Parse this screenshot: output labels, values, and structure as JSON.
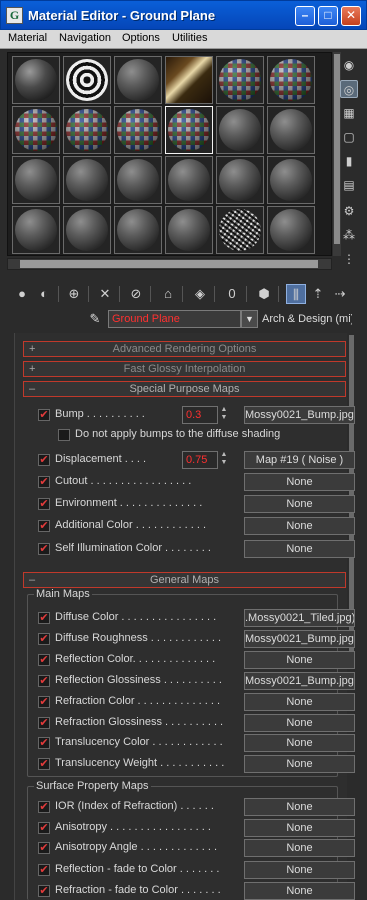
{
  "window": {
    "title": "Material Editor - Ground Plane",
    "app_icon": "G",
    "minimize": "–",
    "maximize": "□",
    "close": "✕"
  },
  "menu": [
    "Material",
    "Navigation",
    "Options",
    "Utilities"
  ],
  "material": {
    "name": "Ground Plane",
    "type": "Arch & Design (mi)"
  },
  "rollouts": {
    "advanced": "Advanced Rendering Options",
    "glossy": "Fast Glossy Interpolation",
    "special": "Special Purpose Maps",
    "general": "General Maps"
  },
  "special_maps": {
    "bump": {
      "label": "Bump . . . . . . . . . .",
      "value": "0.3",
      "map": "Mossy0021_Bump.jpg)"
    },
    "no_bump_diffuse": "Do not apply bumps to the diffuse shading",
    "displacement": {
      "label": "Displacement . . . .",
      "value": "0.75",
      "map": "Map #19  ( Noise )"
    },
    "cutout": {
      "label": "Cutout . . . . . . . . . . . . . . . . .",
      "map": "None"
    },
    "environment": {
      "label": "Environment . . . . . . . . . . . . . .",
      "map": "None"
    },
    "additional_color": {
      "label": "Additional Color . . . . . . . . . . . .",
      "map": "None"
    },
    "self_illum": {
      "label": "Self Illumination Color . . . . . . . .",
      "map": "None"
    }
  },
  "general_maps": {
    "main_title": "Main Maps",
    "main": [
      {
        "label": "Diffuse Color . . . . . . . . . . . . . . . .",
        "map": ".Mossy0021_Tiled.jpg)"
      },
      {
        "label": "Diffuse Roughness . . . . . . . . . . . .",
        "map": "Mossy0021_Bump.jpg)"
      },
      {
        "label": "Reflection Color. . . . . . . . . . . . . .",
        "map": "None"
      },
      {
        "label": "Reflection Glossiness . . . . . . . . . .",
        "map": "Mossy0021_Bump.jpg)"
      },
      {
        "label": "Refraction Color . . . . . . . . . . . . . .",
        "map": "None"
      },
      {
        "label": "Refraction Glossiness . . . . . . . . . .",
        "map": "None"
      },
      {
        "label": "Translucency Color . . . . . . . . . . . .",
        "map": "None"
      },
      {
        "label": "Translucency Weight . . . . . . . . . . .",
        "map": "None"
      }
    ],
    "surface_title": "Surface Property Maps",
    "surface": [
      {
        "label": "IOR (Index of Refraction) . . . . . .",
        "map": "None"
      },
      {
        "label": "Anisotropy . . . . . . . . . . . . . . . . .",
        "map": "None"
      },
      {
        "label": "Anisotropy Angle . . . . . . . . . . . . .",
        "map": "None"
      },
      {
        "label": "Reflection - fade to Color . . . . . . .",
        "map": "None"
      },
      {
        "label": "Refraction - fade to Color . . . . . . .",
        "map": "None"
      }
    ]
  },
  "icons": {
    "check": "✔",
    "plus": "+",
    "minus": "–",
    "dropdown": "▼",
    "spin_up": "▲",
    "spin_down": "▼",
    "picker": "✎"
  },
  "colors": {
    "accent_red": "#c0392b",
    "value_red": "#ff3030",
    "title_blue": "#0a5fd8"
  }
}
